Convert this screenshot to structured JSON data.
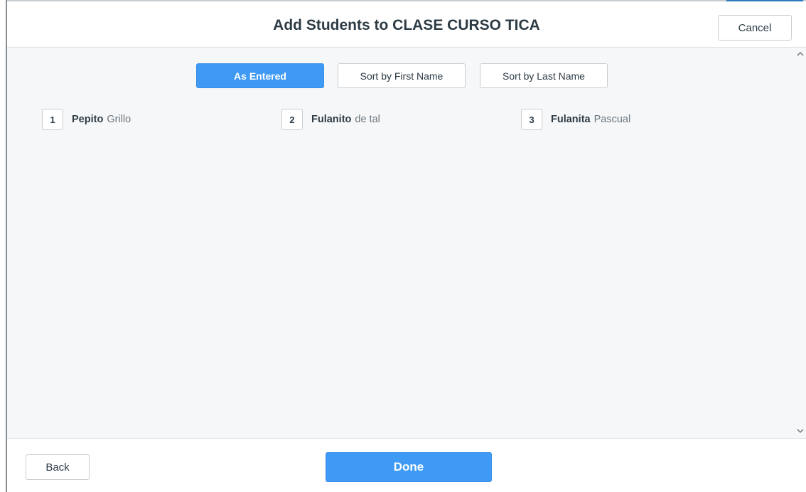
{
  "modal": {
    "title": "Add Students to CLASE CURSO TICA",
    "cancel_label": "Cancel"
  },
  "sort_options": {
    "as_entered": "As Entered",
    "first_name": "Sort by First Name",
    "last_name": "Sort by Last Name",
    "selected": "As Entered"
  },
  "students": [
    {
      "number": "1",
      "first": "Pepito",
      "last": "Grillo"
    },
    {
      "number": "2",
      "first": "Fulanito",
      "last": "de tal"
    },
    {
      "number": "3",
      "first": "Fulanita",
      "last": "Pascual"
    }
  ],
  "footer": {
    "back_label": "Back",
    "done_label": "Done"
  },
  "icons": {
    "scroll_up": "chevron-up-icon",
    "scroll_down": "chevron-down-icon"
  },
  "colors": {
    "primary": "#3f9af6",
    "content_bg": "#f6f7f8",
    "text": "#2d3b45",
    "muted_text": "#6b7780"
  }
}
